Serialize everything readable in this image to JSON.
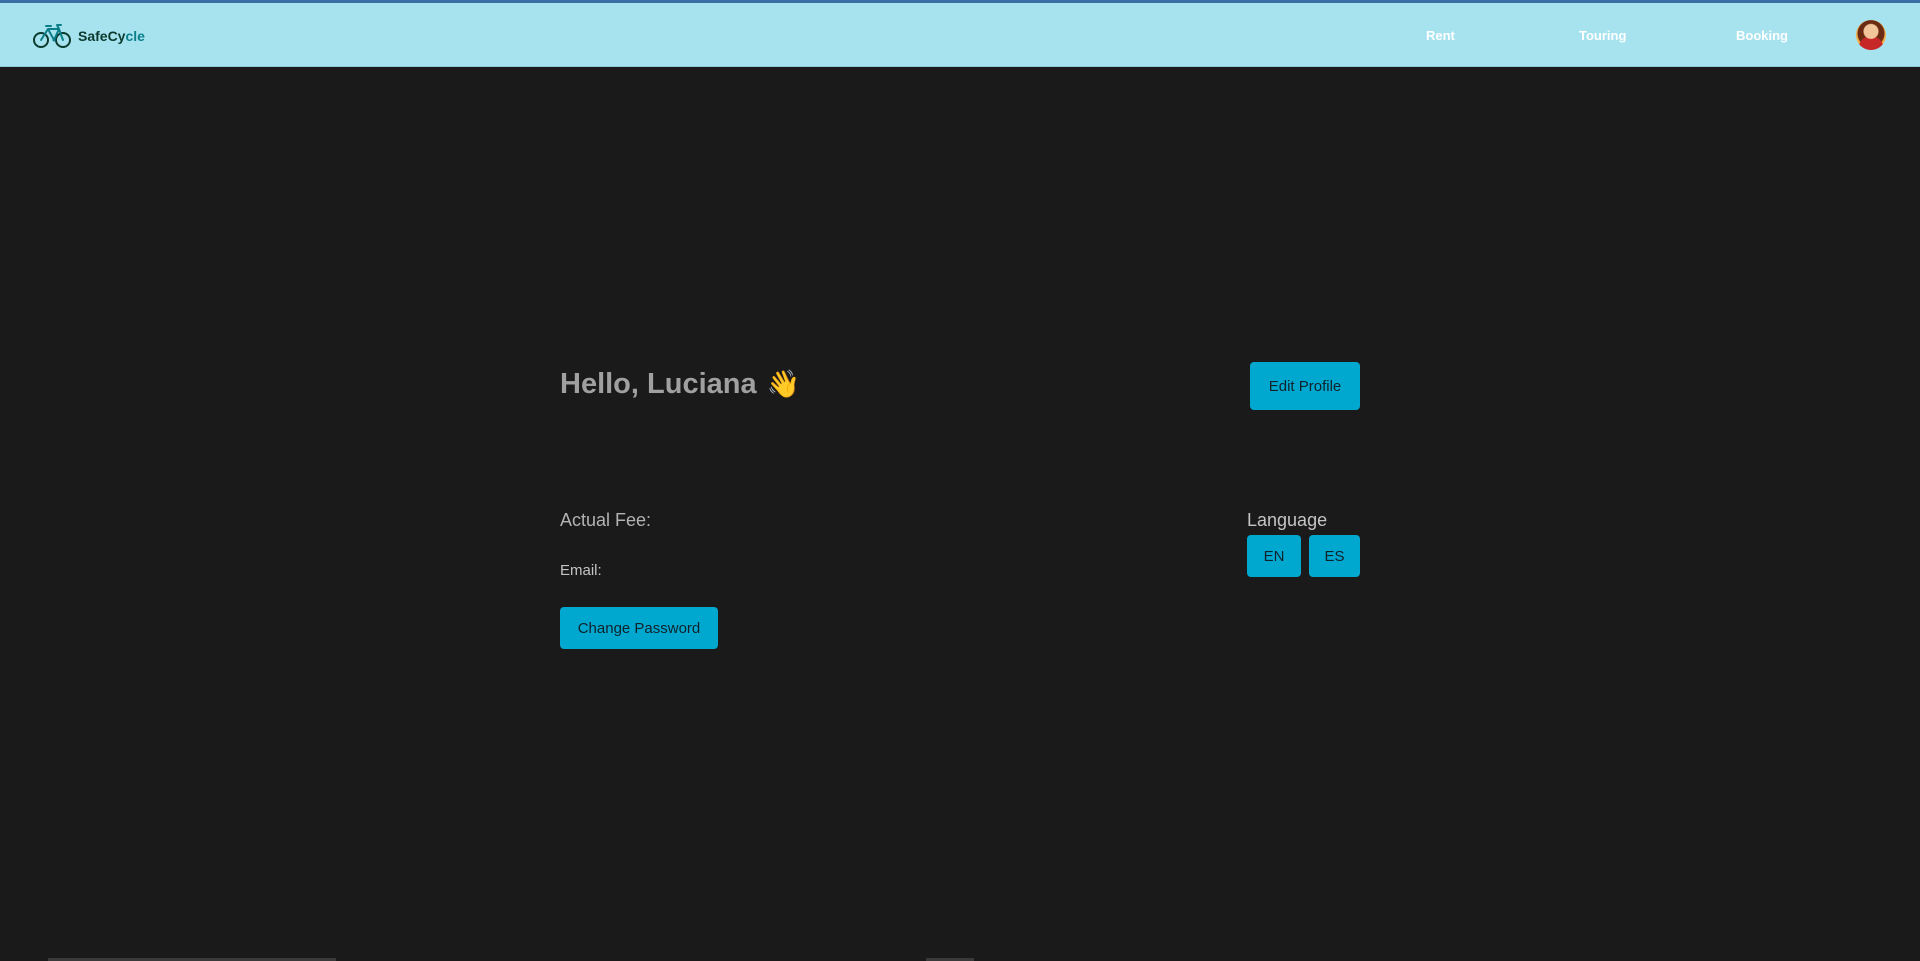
{
  "navbar": {
    "brand_primary": "SafeCy",
    "brand_accent": "cle",
    "links": [
      {
        "label": "Rent"
      },
      {
        "label": "Touring"
      },
      {
        "label": "Booking"
      }
    ],
    "background_color": "#a7e3ee"
  },
  "profile": {
    "greeting": "Hello, Luciana",
    "wave_emoji": "👋",
    "edit_button": "Edit Profile",
    "fee_label": "Actual Fee:",
    "email_label": "Email:",
    "change_password_button": "Change Password"
  },
  "language": {
    "label": "Language",
    "options": [
      "EN",
      "ES"
    ]
  },
  "colors": {
    "page_background": "#1a1a1a",
    "button": "#00a8d0",
    "greeting_text": "#a0a0a0"
  },
  "icons": {
    "logo": "bicycle-icon",
    "avatar": "user-avatar"
  }
}
